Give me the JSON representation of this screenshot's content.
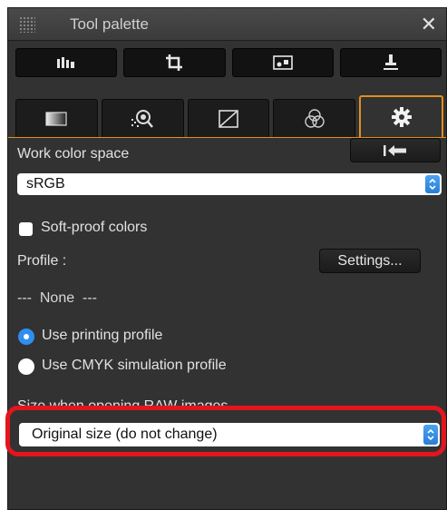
{
  "titlebar": {
    "title": "Tool palette"
  },
  "toolbar": {
    "icons": [
      "histogram-icon",
      "crop-icon",
      "image-icon",
      "stamp-icon"
    ]
  },
  "tabs": {
    "icons": [
      "image-tab-icon",
      "lens-tab-icon",
      "curve-tab-icon",
      "color-tab-icon",
      "gear-tab-icon"
    ],
    "active": 4
  },
  "work_color_space": {
    "label": "Work color space",
    "value": "sRGB"
  },
  "soft_proof": {
    "label": "Soft-proof colors",
    "checked": false
  },
  "profile": {
    "label": "Profile :",
    "settings_label": "Settings...",
    "value": "---  None  ---"
  },
  "printing": {
    "use_printing_label": "Use printing profile",
    "use_cmyk_label": "Use CMYK simulation profile",
    "selected": "use_printing"
  },
  "raw_size": {
    "label": "Size when opening RAW images",
    "value": "Original size (do not change)"
  },
  "colors": {
    "accent": "#e08f20",
    "highlight": "#e3151e",
    "select_blue": "#2f8ff0"
  }
}
